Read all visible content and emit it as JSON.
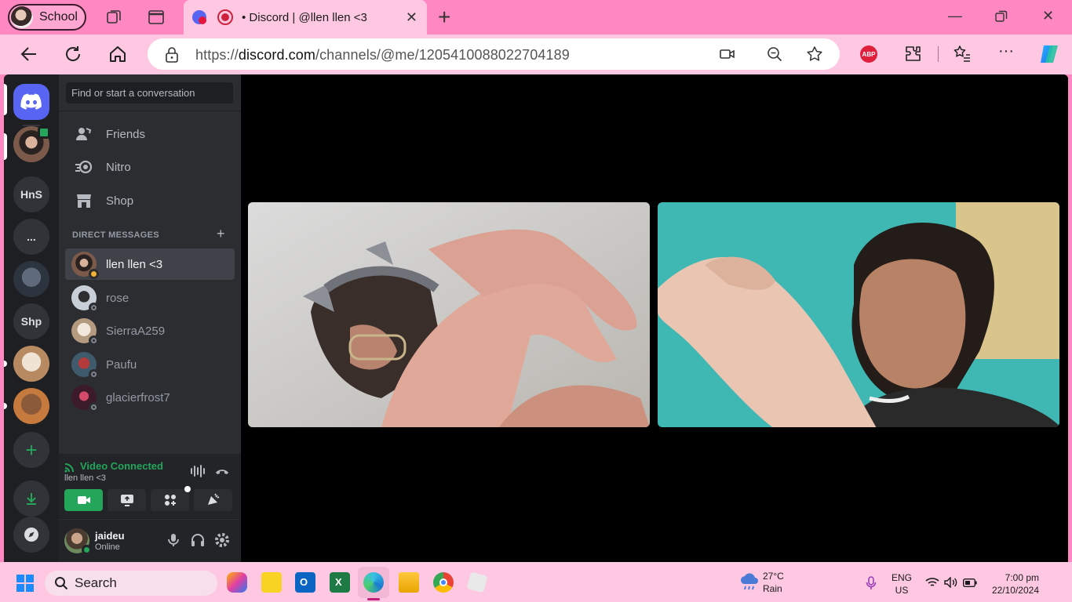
{
  "browser": {
    "profile_label": "School",
    "tab_title": "• Discord | @llen llen <3",
    "url_prefix": "https://",
    "url_domain": "discord.com",
    "url_path": "/channels/@me/1205410088022704189",
    "abp_label": "ABP"
  },
  "discord": {
    "guilds": [
      "HnS",
      "...",
      "Shp"
    ],
    "search_placeholder": "Find or start a conversation",
    "nav": [
      {
        "label": "Friends",
        "icon": "friends-icon"
      },
      {
        "label": "Nitro",
        "icon": "nitro-icon"
      },
      {
        "label": "Shop",
        "icon": "shop-icon"
      }
    ],
    "dm_header": "DIRECT MESSAGES",
    "dms": [
      {
        "name": "llen llen <3",
        "active": true,
        "status": "idle"
      },
      {
        "name": "rose",
        "active": false,
        "status": "offline"
      },
      {
        "name": "SierraA259",
        "active": false,
        "status": "offline"
      },
      {
        "name": "Paufu",
        "active": false,
        "status": "offline"
      },
      {
        "name": "glacierfrost7",
        "active": false,
        "status": "offline"
      }
    ],
    "voice": {
      "status": "Video Connected",
      "channel": "llen llen <3"
    },
    "user": {
      "name": "jaideu",
      "status": "Online"
    }
  },
  "taskbar": {
    "search_label": "Search",
    "weather_temp": "27°C",
    "weather_desc": "Rain",
    "lang_top": "ENG",
    "lang_bottom": "US",
    "time": "7:00 pm",
    "date": "22/10/2024"
  },
  "colors": {
    "browser_frame": "#ff88c2",
    "toolbar": "#ffc8e2",
    "blurple": "#5865f2",
    "green": "#23a55a"
  }
}
